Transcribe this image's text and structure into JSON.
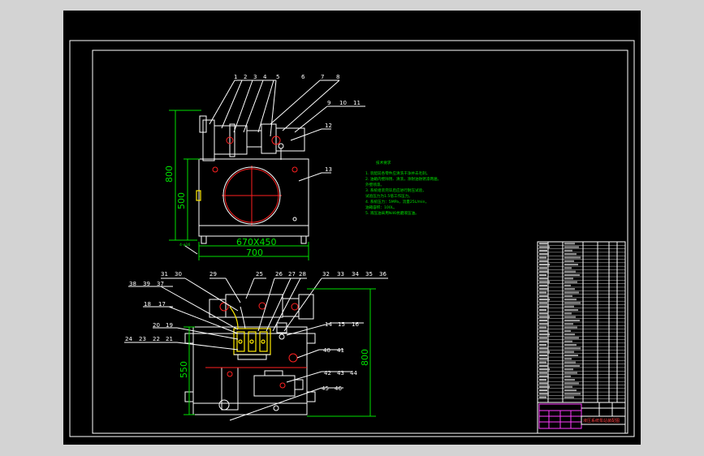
{
  "top_view": {
    "part_numbers": [
      "1",
      "2",
      "3",
      "4",
      "5",
      "6",
      "7",
      "8",
      "9",
      "10",
      "11",
      "12",
      "13"
    ],
    "dims": {
      "height_total": "800",
      "height_body": "500",
      "width_inner": "670X450",
      "width_outer": "700",
      "leg": "4-φ16"
    }
  },
  "bottom_view": {
    "part_numbers_top": [
      "31",
      "30",
      "29",
      "25",
      "26",
      "27",
      "28",
      "32",
      "33",
      "34",
      "35",
      "36"
    ],
    "part_numbers_left": [
      "38",
      "39",
      "37",
      "18",
      "17",
      "20",
      "19",
      "24",
      "23",
      "22",
      "21"
    ],
    "part_numbers_right": [
      "14",
      "15",
      "16",
      "40",
      "41",
      "42",
      "43",
      "44",
      "45",
      "46"
    ],
    "dims": {
      "height_total": "800",
      "height_body": "550"
    }
  },
  "notes": {
    "title": "技术要求",
    "lines": [
      "1. 装配前各零件应清洗干净并去毛刺。",
      "2. 油箱内壁除锈、清洗，涂耐油防锈漆两遍，",
      "   外壁喷漆。",
      "3. 系统组装完毕后应进行耐压试验，",
      "   试验压力为1.5倍工作压力。",
      "4. 系统压力：5MPa，流量25L/min，",
      "   油箱容积：100L。",
      "5. 液压油采用N46抗磨液压油。"
    ]
  },
  "title_block": {
    "drawing_name": "液压系统泵站装配图"
  }
}
